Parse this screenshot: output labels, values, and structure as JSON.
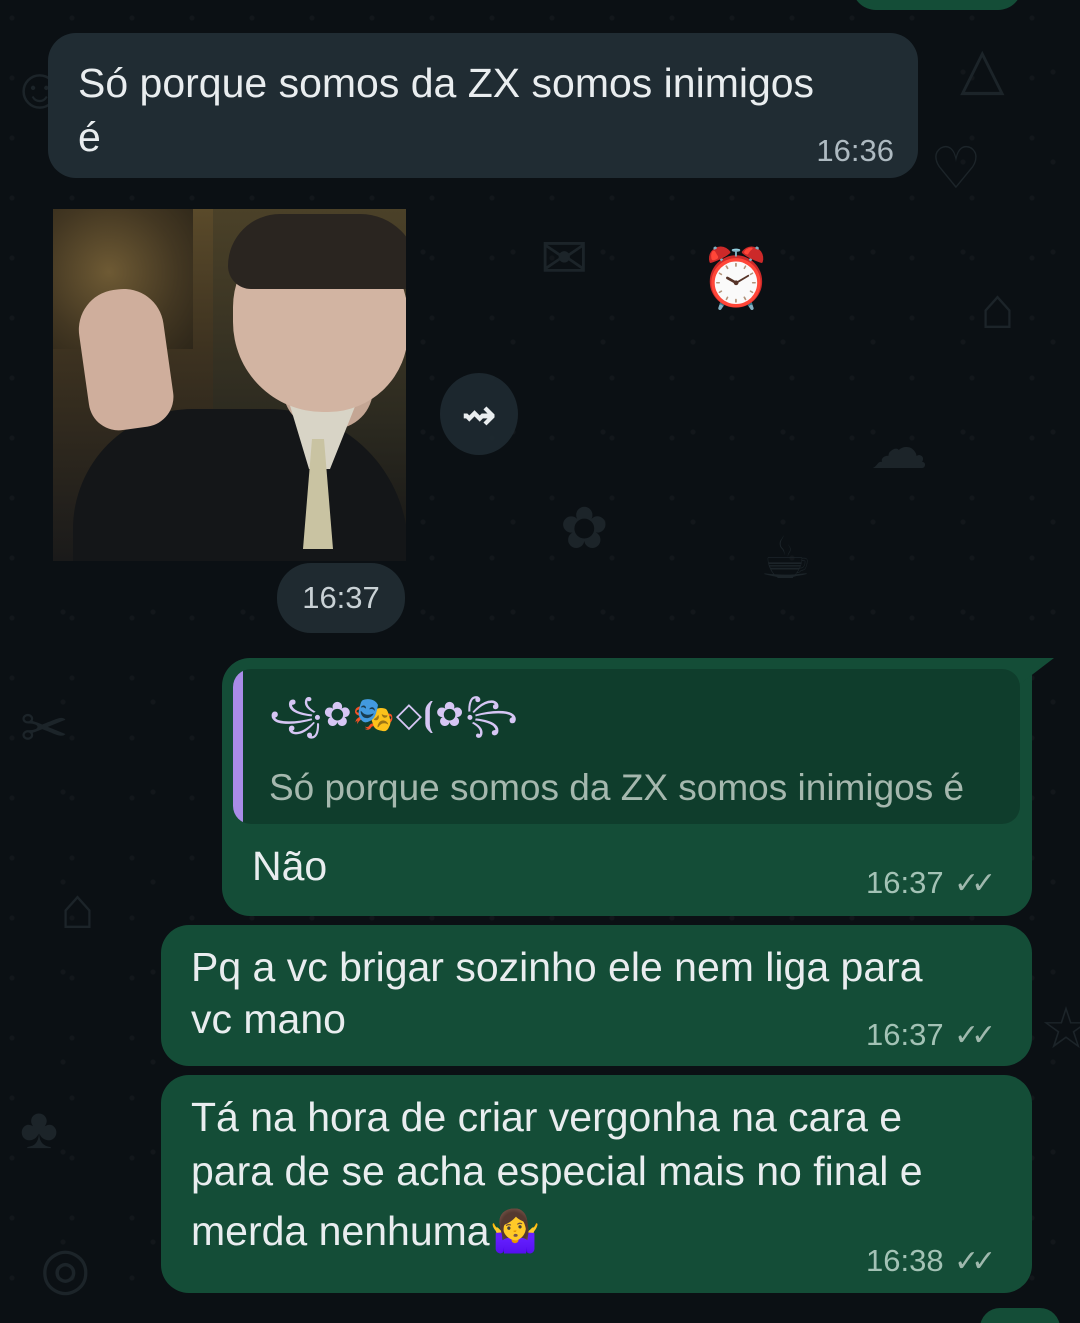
{
  "messages": [
    {
      "direction": "incoming",
      "text_line1": "Só porque somos da ZX somos inimigos",
      "text_line2": "é",
      "time": "16:36"
    },
    {
      "direction": "incoming",
      "type": "image",
      "image_description": "man in suit smoking",
      "time": "16:37"
    },
    {
      "direction": "outgoing",
      "reply_to": {
        "author": "꧁✿🎭◇⦗✿꧂",
        "text": "Só porque somos da ZX somos inimigos é"
      },
      "text": "Não",
      "time": "16:37",
      "status": "✓✓"
    },
    {
      "direction": "outgoing",
      "text_line1": "Pq a vc brigar sozinho ele nem liga para",
      "text_line2": "vc mano",
      "time": "16:37",
      "status": "✓✓"
    },
    {
      "direction": "outgoing",
      "text_line1": "Tá na hora de criar vergonha na cara e",
      "text_line2": "para de se acha especial mais no final e",
      "text_line3": "merda nenhuma",
      "emoji": "🤷‍♀️",
      "time": "16:38",
      "status": "✓✓"
    }
  ],
  "icons": {
    "forward": "forward-icon"
  },
  "colors": {
    "background": "#0b1014",
    "incoming": "#202c33",
    "outgoing": "#144d37",
    "reply_bar": "#a98ce8"
  }
}
